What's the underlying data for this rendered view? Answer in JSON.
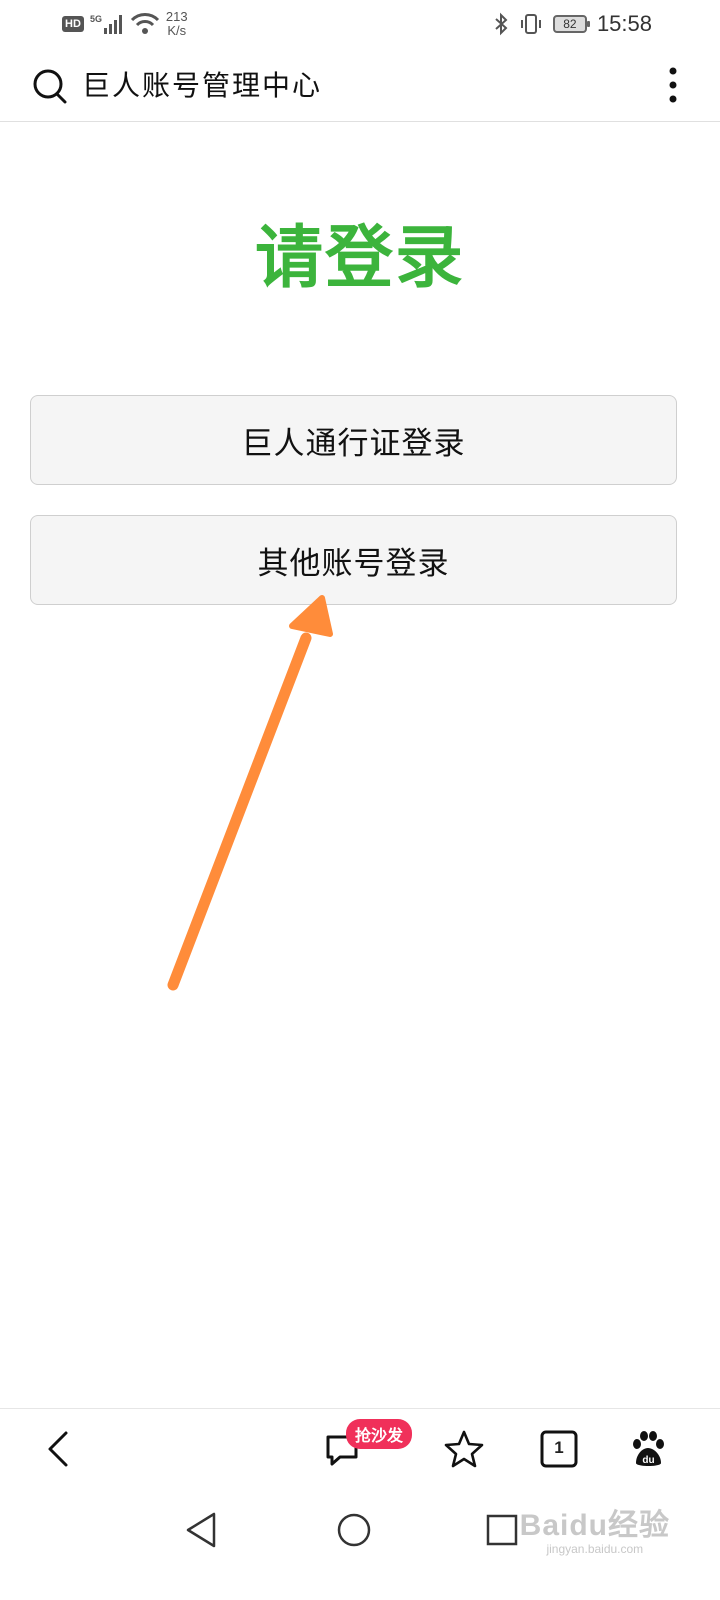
{
  "status_bar": {
    "hd": "HD",
    "network": "5G",
    "speed_value": "213",
    "speed_unit": "K/s",
    "battery": "82",
    "time": "15:58"
  },
  "header": {
    "title": "巨人账号管理中心"
  },
  "main": {
    "heading": "请登录",
    "buttons": [
      {
        "label": "巨人通行证登录"
      },
      {
        "label": "其他账号登录"
      }
    ]
  },
  "toolbar": {
    "sofa_badge": "抢沙发",
    "tabs_count": "1"
  },
  "watermark": {
    "main": "Baidu经验",
    "sub": "jingyan.baidu.com"
  },
  "colors": {
    "heading": "#3cb43c",
    "arrow": "#ff8c3a",
    "badge": "#f0305a"
  }
}
